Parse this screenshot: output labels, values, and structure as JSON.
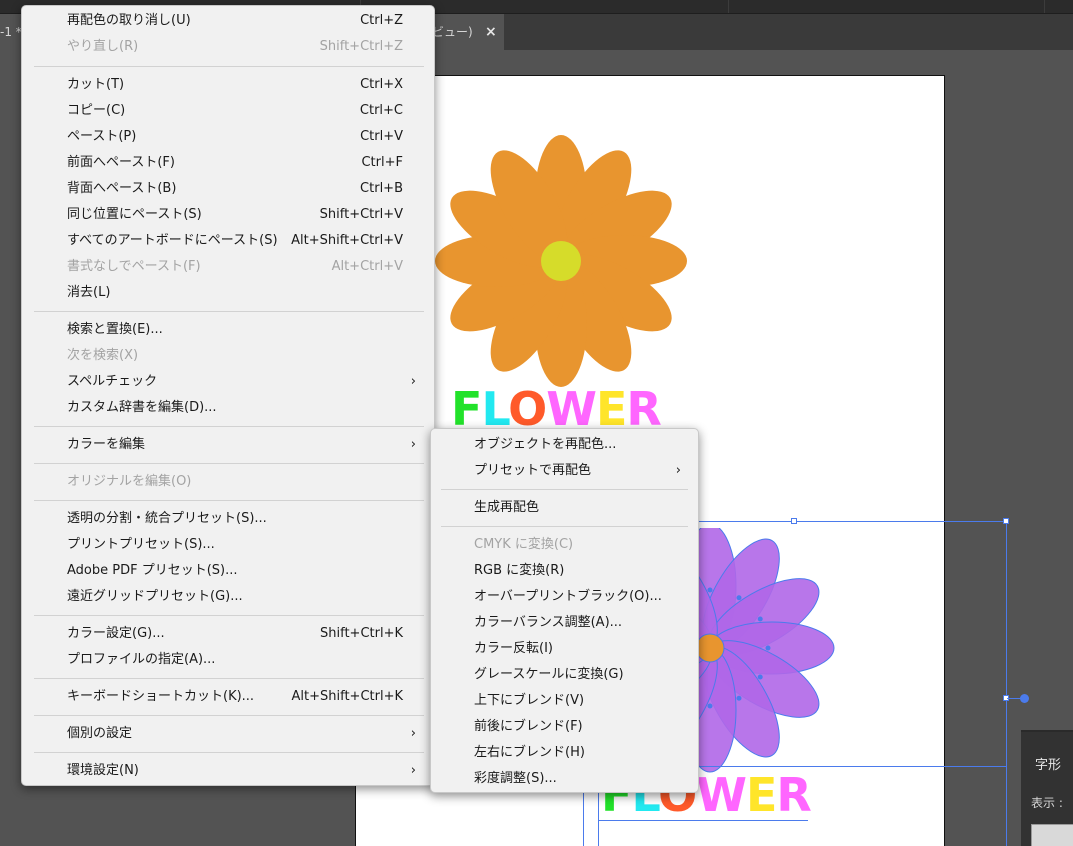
{
  "document": {
    "tab_left_label": "-1 *",
    "tab_right_label": "ビュー)",
    "tab_close_glyph": "×",
    "artwork_text_top": "FLOWER",
    "artwork_text_bottom": "FLOWER",
    "flower_colors": {
      "petal_top": "#e8952f",
      "center_top": "#d6dc2a",
      "petal_bottom": "#b067e8",
      "center_bottom": "#e8952f"
    },
    "letter_colors": {
      "F": "#22e22a",
      "L": "#22e9f0",
      "O": "#ff5a2a",
      "W": "#ff66ff",
      "E": "#ffe52a",
      "R": "#ff66ff"
    }
  },
  "glyph_panel": {
    "title": "字形",
    "show_label": "表示 :"
  },
  "edit_menu": {
    "items": [
      {
        "label": "再配色の取り消し(U)",
        "shortcut": "Ctrl+Z",
        "disabled": false
      },
      {
        "label": "やり直し(R)",
        "shortcut": "Shift+Ctrl+Z",
        "disabled": true
      },
      {
        "label": "カット(T)",
        "shortcut": "Ctrl+X",
        "disabled": false
      },
      {
        "label": "コピー(C)",
        "shortcut": "Ctrl+C",
        "disabled": false
      },
      {
        "label": "ペースト(P)",
        "shortcut": "Ctrl+V",
        "disabled": false
      },
      {
        "label": "前面へペースト(F)",
        "shortcut": "Ctrl+F",
        "disabled": false
      },
      {
        "label": "背面へペースト(B)",
        "shortcut": "Ctrl+B",
        "disabled": false
      },
      {
        "label": "同じ位置にペースト(S)",
        "shortcut": "Shift+Ctrl+V",
        "disabled": false
      },
      {
        "label": "すべてのアートボードにペースト(S)",
        "shortcut": "Alt+Shift+Ctrl+V",
        "disabled": false
      },
      {
        "label": "書式なしでペースト(F)",
        "shortcut": "Alt+Ctrl+V",
        "disabled": true
      },
      {
        "label": "消去(L)",
        "shortcut": "",
        "disabled": false
      },
      {
        "label": "検索と置換(E)...",
        "shortcut": "",
        "disabled": false
      },
      {
        "label": "次を検索(X)",
        "shortcut": "",
        "disabled": true
      },
      {
        "label": "スペルチェック",
        "shortcut": "",
        "disabled": false
      },
      {
        "label": "カスタム辞書を編集(D)...",
        "shortcut": "",
        "disabled": false
      },
      {
        "label": "カラーを編集",
        "shortcut": "",
        "disabled": false
      },
      {
        "label": "オリジナルを編集(O)",
        "shortcut": "",
        "disabled": true
      },
      {
        "label": "透明の分割・統合プリセット(S)...",
        "shortcut": "",
        "disabled": false
      },
      {
        "label": "プリントプリセット(S)...",
        "shortcut": "",
        "disabled": false
      },
      {
        "label": "Adobe PDF プリセット(S)...",
        "shortcut": "",
        "disabled": false
      },
      {
        "label": "遠近グリッドプリセット(G)...",
        "shortcut": "",
        "disabled": false
      },
      {
        "label": "カラー設定(G)...",
        "shortcut": "Shift+Ctrl+K",
        "disabled": false
      },
      {
        "label": "プロファイルの指定(A)...",
        "shortcut": "",
        "disabled": false
      },
      {
        "label": "キーボードショートカット(K)...",
        "shortcut": "Alt+Shift+Ctrl+K",
        "disabled": false
      },
      {
        "label": "個別の設定",
        "shortcut": "",
        "disabled": false
      },
      {
        "label": "環境設定(N)",
        "shortcut": "",
        "disabled": false
      }
    ],
    "submenu_arrow": "›"
  },
  "color_submenu": {
    "items": [
      {
        "label": "オブジェクトを再配色...",
        "disabled": false
      },
      {
        "label": "プリセットで再配色",
        "disabled": false
      },
      {
        "label": "生成再配色",
        "disabled": false
      },
      {
        "label": "CMYK に変換(C)",
        "disabled": true
      },
      {
        "label": "RGB に変換(R)",
        "disabled": false
      },
      {
        "label": "オーバープリントブラック(O)...",
        "disabled": false
      },
      {
        "label": "カラーバランス調整(A)...",
        "disabled": false
      },
      {
        "label": "カラー反転(I)",
        "disabled": false
      },
      {
        "label": "グレースケールに変換(G)",
        "disabled": false
      },
      {
        "label": "上下にブレンド(V)",
        "disabled": false
      },
      {
        "label": "前後にブレンド(F)",
        "disabled": false
      },
      {
        "label": "左右にブレンド(H)",
        "disabled": false
      },
      {
        "label": "彩度調整(S)...",
        "disabled": false
      }
    ]
  }
}
